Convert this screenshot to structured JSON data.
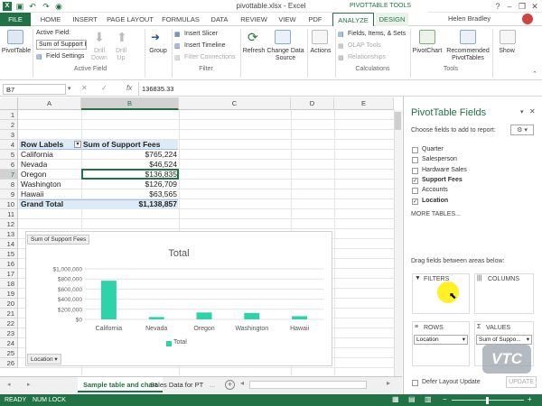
{
  "window": {
    "title": "pivottable.xlsx - Excel",
    "user": "Helen Bradley",
    "qa_icons": [
      "save-icon",
      "undo-icon",
      "redo-icon",
      "camera-icon"
    ]
  },
  "tabs": [
    "FILE",
    "HOME",
    "INSERT",
    "PAGE LAYOUT",
    "FORMULAS",
    "DATA",
    "REVIEW",
    "VIEW",
    "PDF",
    "ANALYZE",
    "DESIGN"
  ],
  "context_tab_group": "PIVOTTABLE TOOLS",
  "ribbon": {
    "pivottable_btn": "PivotTable",
    "active_field_label": "Active Field:",
    "active_field_value": "Sum of Support Fe",
    "field_settings": "Field Settings",
    "drill_down": "Drill\nDown",
    "drill_up": "Drill\nUp",
    "group": "Group",
    "insert_slicer": "Insert Slicer",
    "insert_timeline": "Insert Timeline",
    "filter_connections": "Filter Connections",
    "refresh": "Refresh",
    "change_data_source": "Change Data\nSource",
    "actions": "Actions",
    "fields_items_sets": "Fields, Items, & Sets",
    "olap_tools": "OLAP Tools",
    "relationships": "Relationships",
    "pivotchart": "PivotChart",
    "recommended": "Recommended\nPivotTables",
    "show": "Show",
    "groups": {
      "active_field": "Active Field",
      "filter": "Filter",
      "calculations": "Calculations",
      "tools": "Tools"
    }
  },
  "formula_bar": {
    "name_box": "B7",
    "value": "136835.33"
  },
  "columns": [
    "A",
    "B",
    "C",
    "D",
    "E"
  ],
  "rows": [
    "1",
    "2",
    "3",
    "4",
    "5",
    "6",
    "7",
    "8",
    "9",
    "10",
    "11",
    "12",
    "13",
    "14",
    "15",
    "16",
    "17",
    "18",
    "19",
    "20",
    "21",
    "22",
    "23",
    "24",
    "25",
    "26"
  ],
  "pivot": {
    "header_labels": "Row Labels",
    "header_values": "Sum of Support Fees",
    "rows": [
      {
        "label": "California",
        "value": "$765,224"
      },
      {
        "label": "Nevada",
        "value": "$46,524"
      },
      {
        "label": "Oregon",
        "value": "$136,835"
      },
      {
        "label": "Washington",
        "value": "$126,709"
      },
      {
        "label": "Hawaii",
        "value": "$63,565"
      }
    ],
    "total_label": "Grand Total",
    "total_value": "$1,138,857"
  },
  "chart_data": {
    "type": "bar",
    "title": "Total",
    "field_button": "Sum of Support Fees",
    "axis_button": "Location",
    "categories": [
      "California",
      "Nevada",
      "Oregon",
      "Washington",
      "Hawaii"
    ],
    "series": [
      {
        "name": "Total",
        "values": [
          765224,
          46524,
          136835,
          126709,
          63565
        ],
        "color": "#2ed3a9"
      }
    ],
    "ylim": [
      0,
      1000000
    ],
    "yticks": [
      "$0",
      "$200,000",
      "$400,000",
      "$600,000",
      "$800,000",
      "$1,000,000"
    ],
    "legend": "bottom"
  },
  "sheets": [
    "Sample table and chart",
    "Sales Data for PT"
  ],
  "sheet_more": "...",
  "status": {
    "ready": "READY",
    "numlock": "NUM LOCK"
  },
  "pane": {
    "title": "PivotTable Fields",
    "subtitle": "Choose fields to add to report:",
    "fields": [
      {
        "name": "Quarter",
        "checked": false
      },
      {
        "name": "Salesperson",
        "checked": false
      },
      {
        "name": "Hardware Sales",
        "checked": false
      },
      {
        "name": "Support Fees",
        "checked": true
      },
      {
        "name": "Accounts",
        "checked": false
      },
      {
        "name": "Location",
        "checked": true
      }
    ],
    "more_tables": "MORE TABLES...",
    "drag_label": "Drag fields between areas below:",
    "filters": "FILTERS",
    "columns": "COLUMNS",
    "rows": "ROWS",
    "values": "VALUES",
    "rows_item": "Location",
    "values_item": "Sum of Suppo...",
    "defer": "Defer Layout Update",
    "update": "UPDATE",
    "watermark": "VTC"
  },
  "colors": {
    "excel_green": "#217346",
    "pivot_header": "#ddebf7",
    "bar": "#2ed3a9"
  }
}
